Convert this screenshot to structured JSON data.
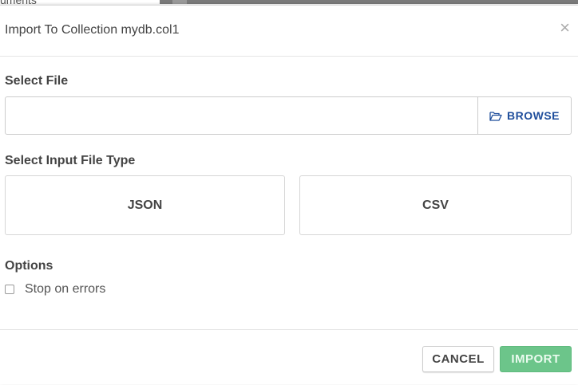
{
  "backdrop": {
    "text": "uments"
  },
  "modal": {
    "title": "Import To Collection mydb.col1",
    "close_glyph": "×"
  },
  "select_file": {
    "label": "Select File",
    "input_value": "",
    "browse_label": "BROWSE"
  },
  "file_type": {
    "label": "Select Input File Type",
    "options": [
      "JSON",
      "CSV"
    ]
  },
  "options": {
    "label": "Options",
    "stop_on_errors_label": "Stop on errors",
    "stop_on_errors_checked": false
  },
  "footer": {
    "cancel_label": "CANCEL",
    "import_label": "IMPORT"
  },
  "colors": {
    "accent_blue": "#1f4e9c",
    "import_green": "#6cc58a"
  },
  "icons": {
    "browse": "folder-open-icon",
    "close": "close-icon"
  }
}
